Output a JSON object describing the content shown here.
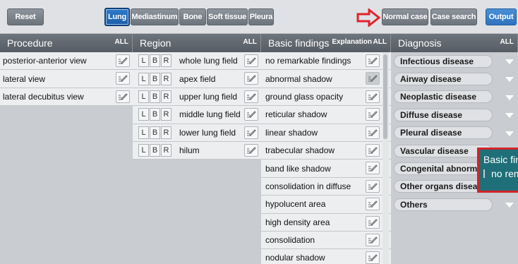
{
  "toolbar": {
    "reset_label": "Reset",
    "tabs": [
      "Lung",
      "Mediastinum",
      "Bone",
      "Soft tissue",
      "Pleura"
    ],
    "normal_case_label": "Normal case",
    "case_search_label": "Case search",
    "output_label": "Output"
  },
  "procedure": {
    "header": "Procedure",
    "all_label": "ALL",
    "items": [
      "posterior-anterior view",
      "lateral view",
      "lateral decubitus view"
    ]
  },
  "region": {
    "header": "Region",
    "all_label": "ALL",
    "lbr": [
      "L",
      "B",
      "R"
    ],
    "items": [
      "whole lung field",
      "apex field",
      "upper lung field",
      "middle lung field",
      "lower lung field",
      "hilum"
    ]
  },
  "basic_findings": {
    "header": "Basic findings",
    "explanation_label": "Explanation",
    "all_label": "ALL",
    "items": [
      "no remarkable findings",
      "abnormal shadow",
      "ground glass opacity",
      "reticular shadow",
      "linear shadow",
      "trabecular shadow",
      "band like shadow",
      "consolidation in diffuse",
      "hypolucent area",
      "high density area",
      "consolidation",
      "nodular shadow"
    ]
  },
  "diagnosis": {
    "header": "Diagnosis",
    "all_label": "ALL",
    "items": [
      "Infectious disease",
      "Airway disease",
      "Neoplastic disease",
      "Diffuse disease",
      "Pleural disease",
      "Vascular disease",
      "Congenital abnormality",
      "Other organs disease",
      "Others"
    ]
  },
  "popup": {
    "title": "Basic findings",
    "option": "no remarkable findings"
  },
  "colors": {
    "header_bg": "#5f666d",
    "accent_blue": "#1d5ea8",
    "arrow_red": "#e2232a",
    "popup_bg": "#1e6f78"
  }
}
